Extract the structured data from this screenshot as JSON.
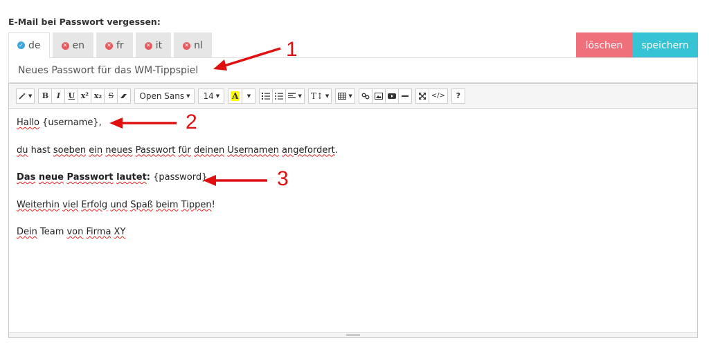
{
  "section_title": "E-Mail bei Passwort vergessen:",
  "tabs": [
    {
      "label": "de",
      "status": "ok"
    },
    {
      "label": "en",
      "status": "missing"
    },
    {
      "label": "fr",
      "status": "missing"
    },
    {
      "label": "it",
      "status": "missing"
    },
    {
      "label": "nl",
      "status": "missing"
    }
  ],
  "buttons": {
    "delete": "löschen",
    "save": "speichern"
  },
  "colors": {
    "delete": "#ef6f7a",
    "save": "#36c3d3",
    "ok_dot": "#3aa7de",
    "missing_dot": "#e8595f",
    "annotation": "#e01010"
  },
  "subject": "Neues Passwort für das WM-Tippspiel",
  "toolbar": {
    "font_family": "Open Sans",
    "font_size": "14",
    "highlight_letter": "A",
    "help": "?"
  },
  "body": {
    "line1_a": "Hallo",
    "line1_b": " {username},",
    "line2_w1": "du",
    "line2_t1": " hast ",
    "line2_w2": "soeben",
    "line2_t2": " ",
    "line2_w3": "ein",
    "line2_t3": " ",
    "line2_w4": "neues",
    "line2_t4": " ",
    "line2_w5": "Passwort",
    "line2_t5": " ",
    "line2_w6": "für",
    "line2_t6": " ",
    "line2_w7": "deinen",
    "line2_t7": " ",
    "line2_w8": "Usernamen",
    "line2_t8": " ",
    "line2_w9": "angefordert",
    "line2_t9": ".",
    "line3_w1": "Das",
    "line3_t1": " ",
    "line3_w2": "neue",
    "line3_t2": " ",
    "line3_w3": "Passwort",
    "line3_t3": " ",
    "line3_w4": "lautet",
    "line3_t4": ":",
    "line3_value": " {password}",
    "line4_w1": "Weiterhin",
    "line4_t1": " ",
    "line4_w2": "viel",
    "line4_t2": " ",
    "line4_w3": "Erfolg",
    "line4_t3": " ",
    "line4_w4": "und",
    "line4_t4": " ",
    "line4_w5": "Spaß",
    "line4_t5": " ",
    "line4_w6": "beim",
    "line4_t6": " ",
    "line4_w7": "Tippen",
    "line4_t7": "!",
    "line5_w1": "Dein",
    "line5_t1": " Team ",
    "line5_w2": "von",
    "line5_t2": " ",
    "line5_w3": "Firma",
    "line5_t3": " ",
    "line5_w4": "XY"
  },
  "annotations": [
    "1",
    "2",
    "3"
  ]
}
